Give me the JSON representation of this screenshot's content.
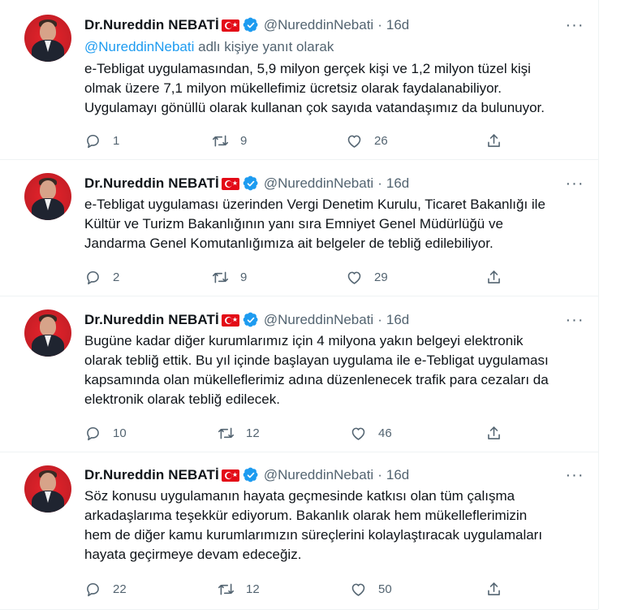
{
  "tweets": [
    {
      "name": "Dr.Nureddin NEBATİ",
      "handle": "@NureddinNebati",
      "time": "16d",
      "reply_mention": "@NureddinNebati",
      "reply_suffix": " adlı kişiye yanıt olarak",
      "text": "e-Tebligat uygulamasından, 5,9 milyon gerçek kişi ve 1,2 milyon tüzel kişi\nolmak üzere 7,1 milyon mükellefimiz ücretsiz olarak faydalanabiliyor.\nUygulamayı gönüllü olarak kullanan çok sayıda vatandaşımız da bulunuyor.",
      "replies": "1",
      "retweets": "9",
      "likes": "26"
    },
    {
      "name": "Dr.Nureddin NEBATİ",
      "handle": "@NureddinNebati",
      "time": "16d",
      "text": "e-Tebligat uygulaması üzerinden Vergi Denetim Kurulu, Ticaret Bakanlığı ile\nKültür ve Turizm Bakanlığının yanı sıra Emniyet Genel Müdürlüğü ve\nJandarma Genel Komutanlığımıza ait belgeler de tebliğ edilebiliyor.",
      "replies": "2",
      "retweets": "9",
      "likes": "29"
    },
    {
      "name": "Dr.Nureddin NEBATİ",
      "handle": "@NureddinNebati",
      "time": "16d",
      "text": "Bugüne kadar diğer kurumlarımız için 4 milyona yakın belgeyi elektronik\nolarak tebliğ ettik. Bu yıl içinde başlayan uygulama ile e-Tebligat uygulaması\nkapsamında olan mükelleflerimiz adına düzenlenecek trafik para cezaları da\nelektronik olarak tebliğ edilecek.",
      "replies": "10",
      "retweets": "12",
      "likes": "46"
    },
    {
      "name": "Dr.Nureddin NEBATİ",
      "handle": "@NureddinNebati",
      "time": "16d",
      "text": "Söz konusu uygulamanın hayata geçmesinde katkısı olan tüm çalışma\narkadaşlarıma teşekkür ediyorum. Bakanlık olarak hem mükelleflerimizin\nhem de diğer kamu kurumlarımızın süreçlerini kolaylaştıracak uygulamaları\nhayata geçirmeye devam edeceğiz.",
      "replies": "22",
      "retweets": "12",
      "likes": "50"
    }
  ],
  "colors": {
    "accent": "#1d9bf0",
    "muted": "#536471",
    "flag": "#e30a17"
  },
  "icons": [
    "verified-badge-icon",
    "turkish-flag-icon",
    "more-icon",
    "reply-icon",
    "retweet-icon",
    "like-icon",
    "share-icon"
  ]
}
